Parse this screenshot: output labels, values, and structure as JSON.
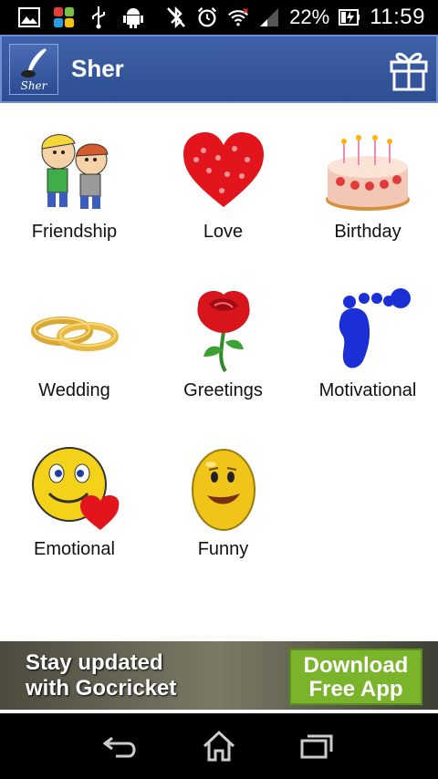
{
  "status_bar": {
    "battery_percent": "22%",
    "time": "11:59",
    "left_icons": [
      "gallery-icon",
      "app-icon",
      "usb-icon",
      "android-icon"
    ],
    "right_icons": [
      "bluetooth-off-icon",
      "alarm-icon",
      "wifi-icon",
      "signal-icon",
      "battery-icon"
    ]
  },
  "app_bar": {
    "logo_text": "Sher",
    "title": "Sher",
    "gift_icon": "gift-icon",
    "color": "#36589c"
  },
  "categories": [
    {
      "label": "Friendship",
      "icon": "friendship-icon"
    },
    {
      "label": "Love",
      "icon": "heart-icon"
    },
    {
      "label": "Birthday",
      "icon": "cake-icon"
    },
    {
      "label": "Wedding",
      "icon": "rings-icon"
    },
    {
      "label": "Greetings",
      "icon": "rose-icon"
    },
    {
      "label": "Motivational",
      "icon": "footprint-icon"
    },
    {
      "label": "Emotional",
      "icon": "smiley-heart-icon"
    },
    {
      "label": "Funny",
      "icon": "egg-face-icon"
    }
  ],
  "ad": {
    "line1": "Stay updated",
    "line2": "with Gocricket",
    "button_line1": "Download",
    "button_line2": "Free App",
    "button_color": "#79b42b"
  },
  "nav": {
    "back": "back-icon",
    "home": "home-icon",
    "recents": "recents-icon"
  }
}
